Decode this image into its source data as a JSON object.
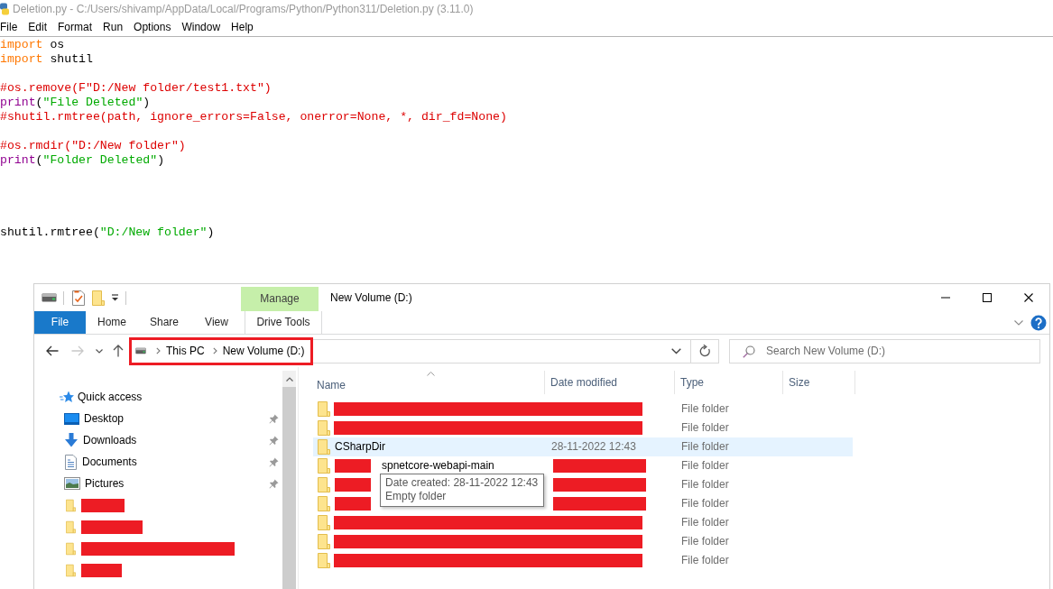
{
  "editor": {
    "title": "Deletion.py - C:/Users/shivamp/AppData/Local/Programs/Python/Python311/Deletion.py (3.11.0)",
    "menu": [
      "File",
      "Edit",
      "Format",
      "Run",
      "Options",
      "Window",
      "Help"
    ],
    "lines": [
      {
        "kind": "code",
        "tokens": [
          {
            "text": "import",
            "kind": "keyword"
          },
          {
            "text": " os",
            "kind": "plain"
          }
        ]
      },
      {
        "kind": "code",
        "tokens": [
          {
            "text": "import",
            "kind": "keyword"
          },
          {
            "text": " shutil",
            "kind": "plain"
          }
        ]
      },
      {
        "kind": "blank"
      },
      {
        "kind": "code",
        "tokens": [
          {
            "text": "#os.remove(F\"D:/New folder/test1.txt\")",
            "kind": "comment"
          }
        ]
      },
      {
        "kind": "code",
        "tokens": [
          {
            "text": "print",
            "kind": "builtin"
          },
          {
            "text": "(",
            "kind": "plain"
          },
          {
            "text": "\"File Deleted\"",
            "kind": "string"
          },
          {
            "text": ")",
            "kind": "plain"
          }
        ]
      },
      {
        "kind": "code",
        "tokens": [
          {
            "text": "#shutil.rmtree(path, ignore_errors=False, onerror=None, *, dir_fd=None)",
            "kind": "comment"
          }
        ]
      },
      {
        "kind": "blank"
      },
      {
        "kind": "code",
        "tokens": [
          {
            "text": "#os.rmdir(\"D:/New folder\")",
            "kind": "comment"
          }
        ]
      },
      {
        "kind": "code",
        "tokens": [
          {
            "text": "print",
            "kind": "builtin"
          },
          {
            "text": "(",
            "kind": "plain"
          },
          {
            "text": "\"Folder Deleted\"",
            "kind": "string"
          },
          {
            "text": ")",
            "kind": "plain"
          }
        ]
      },
      {
        "kind": "blank"
      },
      {
        "kind": "blank"
      },
      {
        "kind": "blank"
      },
      {
        "kind": "blank"
      },
      {
        "kind": "code",
        "tokens": [
          {
            "text": "shutil.rmtree(",
            "kind": "plain"
          },
          {
            "text": "\"D:/New folder\"",
            "kind": "string"
          },
          {
            "text": ")",
            "kind": "plain"
          }
        ]
      }
    ]
  },
  "explorer": {
    "contextual_group": "Manage",
    "title": "New Volume (D:)",
    "ribbon_tabs": [
      {
        "label": "File",
        "kind": "file",
        "selected": false
      },
      {
        "label": "Home",
        "kind": "tab",
        "selected": false
      },
      {
        "label": "Share",
        "kind": "tab",
        "selected": false
      },
      {
        "label": "View",
        "kind": "tab",
        "selected": false
      },
      {
        "label": "Drive Tools",
        "kind": "contextual",
        "selected": false
      }
    ],
    "nav_buttons": [
      {
        "kind": "back",
        "disabled": false
      },
      {
        "kind": "forward",
        "disabled": true
      },
      {
        "kind": "recent",
        "disabled": false
      },
      {
        "kind": "up",
        "disabled": false
      }
    ],
    "address_bar": {
      "path": [
        "This PC",
        "New Volume (D:)"
      ],
      "highlighted": true
    },
    "search": {
      "placeholder": "Search New Volume (D:)"
    },
    "navigation_pane": [
      {
        "label": "Quick access",
        "kind": "quick-access",
        "pinned": false,
        "redacted": false
      },
      {
        "label": "Desktop",
        "kind": "desktop",
        "pinned": true,
        "redacted": false
      },
      {
        "label": "Downloads",
        "kind": "downloads",
        "pinned": true,
        "redacted": false
      },
      {
        "label": "Documents",
        "kind": "documents",
        "pinned": true,
        "redacted": false
      },
      {
        "label": "Pictures",
        "kind": "pictures",
        "pinned": true,
        "redacted": false
      },
      {
        "kind": "folder",
        "pinned": false,
        "redacted": true
      },
      {
        "kind": "folder",
        "pinned": false,
        "redacted": true
      },
      {
        "kind": "folder",
        "pinned": false,
        "redacted": true
      },
      {
        "kind": "folder",
        "pinned": false,
        "redacted": true
      }
    ],
    "file_list": {
      "columns": [
        {
          "label": "Name",
          "sorted": true
        },
        {
          "label": "Date modified",
          "sorted": false
        },
        {
          "label": "Type",
          "sorted": false
        },
        {
          "label": "Size",
          "sorted": false
        }
      ],
      "rows": [
        {
          "kind": "redacted",
          "type": "File folder",
          "hovered": false
        },
        {
          "kind": "redacted",
          "type": "File folder",
          "hovered": false
        },
        {
          "kind": "plain",
          "name": "CSharpDir",
          "date_modified": "28-11-2022 12:43",
          "type": "File folder",
          "hovered": true
        },
        {
          "kind": "partly-redacted",
          "name": "spnetcore-webapi-main",
          "type": "File folder",
          "hovered": false
        },
        {
          "kind": "partly-redacted",
          "type": "File folder",
          "hovered": false
        },
        {
          "kind": "partly-redacted",
          "type": "File folder",
          "hovered": false
        },
        {
          "kind": "redacted",
          "type": "File folder",
          "hovered": false
        },
        {
          "kind": "redacted",
          "type": "File folder",
          "hovered": false
        },
        {
          "kind": "redacted",
          "type": "File folder",
          "hovered": false
        }
      ]
    },
    "tooltip": [
      "Date created: 28-11-2022 12:43",
      "Empty folder"
    ]
  }
}
